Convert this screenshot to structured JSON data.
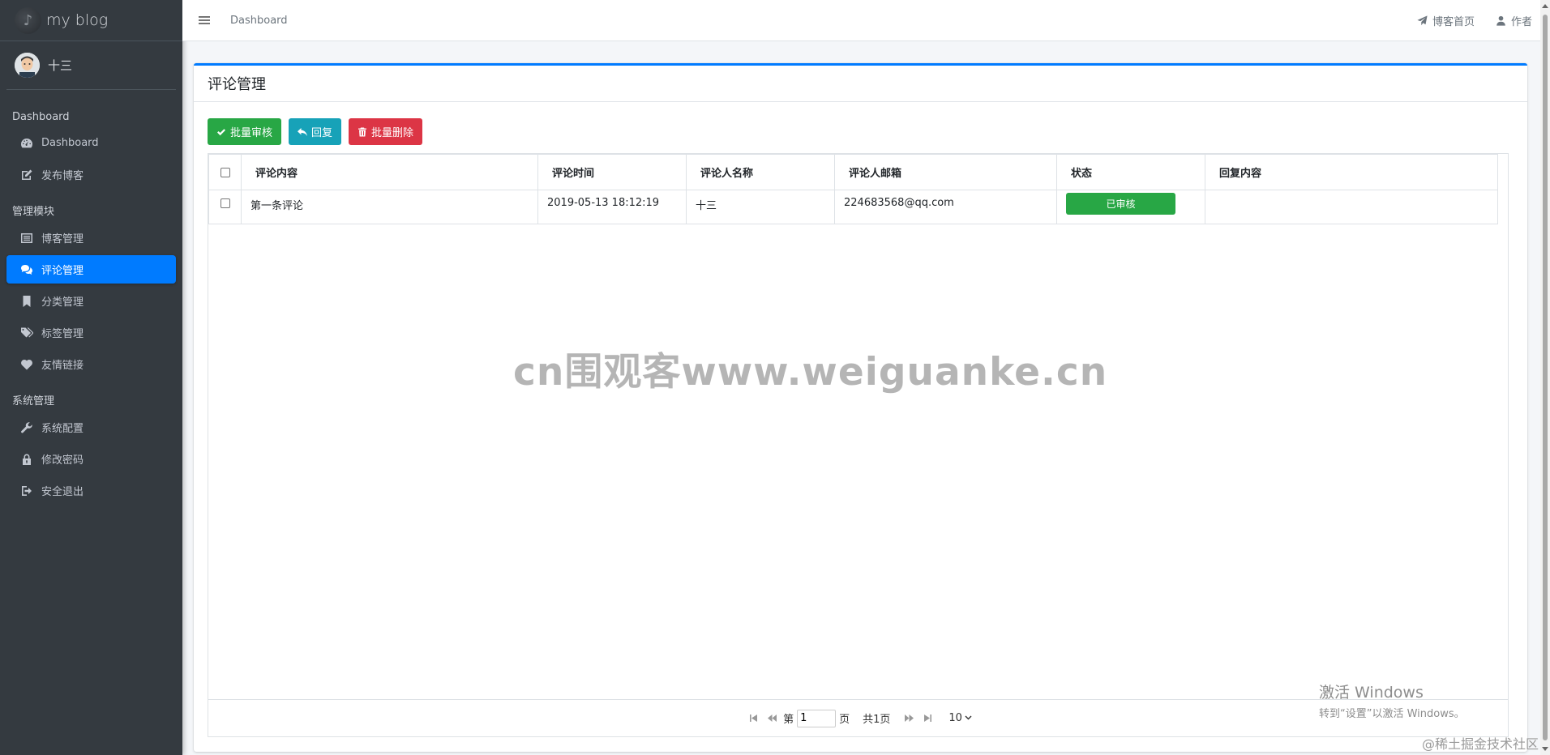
{
  "brand": {
    "title": "my blog"
  },
  "user": {
    "name": "十三"
  },
  "sidebar": {
    "sections": [
      {
        "header": "Dashboard",
        "items": [
          {
            "label": "Dashboard",
            "icon": "dashboard-icon"
          },
          {
            "label": "发布博客",
            "icon": "edit-icon"
          }
        ]
      },
      {
        "header": "管理模块",
        "items": [
          {
            "label": "博客管理",
            "icon": "list-icon"
          },
          {
            "label": "评论管理",
            "icon": "comments-icon",
            "active": true
          },
          {
            "label": "分类管理",
            "icon": "bookmark-icon"
          },
          {
            "label": "标签管理",
            "icon": "tags-icon"
          },
          {
            "label": "友情链接",
            "icon": "heart-icon"
          }
        ]
      },
      {
        "header": "系统管理",
        "items": [
          {
            "label": "系统配置",
            "icon": "wrench-icon"
          },
          {
            "label": "修改密码",
            "icon": "lock-icon"
          },
          {
            "label": "安全退出",
            "icon": "sign-out-icon"
          }
        ]
      }
    ]
  },
  "navbar": {
    "breadcrumb": "Dashboard",
    "home_link": "博客首页",
    "author_link": "作者"
  },
  "card": {
    "title": "评论管理",
    "toolbar": {
      "approve": "批量审核",
      "reply": "回复",
      "delete": "批量删除"
    }
  },
  "table": {
    "columns": [
      "评论内容",
      "评论时间",
      "评论人名称",
      "评论人邮箱",
      "状态",
      "回复内容"
    ],
    "rows": [
      {
        "content": "第一条评论",
        "time": "2019-05-13 18:12:19",
        "name": "十三",
        "email": "224683568@qq.com",
        "status": "已审核",
        "reply": ""
      }
    ]
  },
  "pager": {
    "prefix": "第",
    "current": "1",
    "suffix": "页",
    "total": "共1页",
    "page_size": "10"
  },
  "overlays": {
    "watermark": "cn围观客www.weiguanke.cn",
    "activate_title": "激活 Windows",
    "activate_sub": "转到“设置”以激活 Windows。",
    "footer": "@稀土掘金技术社区"
  },
  "colors": {
    "sidebar_bg": "#343a40",
    "active": "#007bff",
    "success": "#28a745",
    "info": "#17a2b8",
    "danger": "#dc3545"
  }
}
